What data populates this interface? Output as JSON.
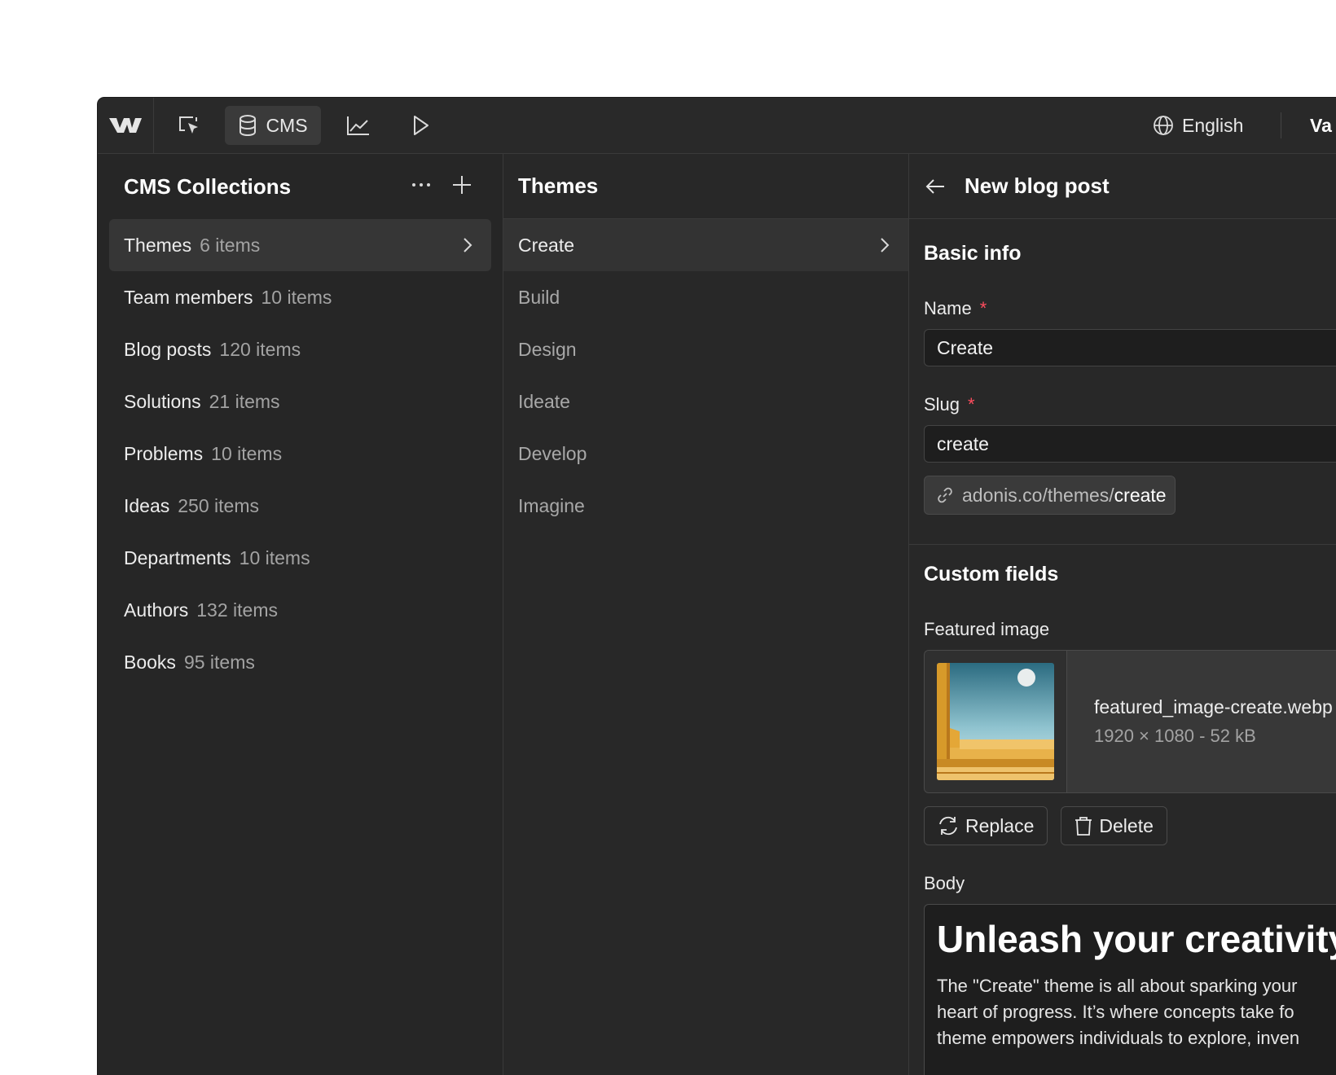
{
  "topbar": {
    "cms_label": "CMS",
    "language": "English",
    "user_label": "Va"
  },
  "collections": {
    "title": "CMS Collections",
    "items": [
      {
        "name": "Themes",
        "count": "6 items"
      },
      {
        "name": "Team members",
        "count": "10 items"
      },
      {
        "name": "Blog posts",
        "count": "120 items"
      },
      {
        "name": "Solutions",
        "count": "21 items"
      },
      {
        "name": "Problems",
        "count": "10 items"
      },
      {
        "name": "Ideas",
        "count": "250 items"
      },
      {
        "name": "Departments",
        "count": "10 items"
      },
      {
        "name": "Authors",
        "count": "132 items"
      },
      {
        "name": "Books",
        "count": "95 items"
      }
    ]
  },
  "themes": {
    "title": "Themes",
    "items": [
      "Create",
      "Build",
      "Design",
      "Ideate",
      "Develop",
      "Imagine"
    ]
  },
  "editor": {
    "title": "New blog post",
    "basic_info": "Basic info",
    "name_label": "Name",
    "name_value": "Create",
    "slug_label": "Slug",
    "slug_value": "create",
    "required_mark": "*",
    "url_prefix": "adonis.co/themes/",
    "url_slug": "create",
    "custom_fields": "Custom fields",
    "featured_image_label": "Featured image",
    "file_name": "featured_image-create.webp",
    "file_meta": "1920 × 1080 - 52 kB",
    "replace_label": "Replace",
    "delete_label": "Delete",
    "body_label": "Body",
    "body_heading": "Unleash your creativity",
    "body_lines": [
      "The \"Create\" theme is all about sparking your",
      "heart of progress. It’s where concepts take fo",
      "theme empowers individuals to explore, inven"
    ]
  },
  "colors": {
    "app_bg": "#262626",
    "required": "#ff4d5e",
    "text": "#ececec",
    "muted": "#a3a3a3"
  }
}
